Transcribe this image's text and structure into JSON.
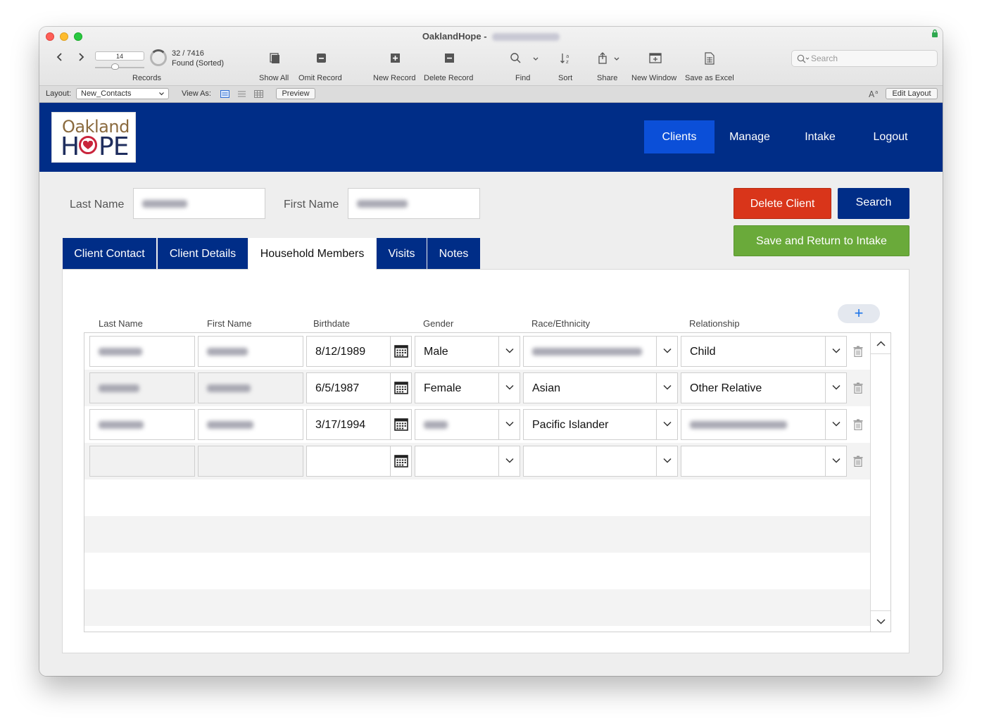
{
  "window": {
    "title": "OaklandHope - "
  },
  "toolbar": {
    "record_number": "14",
    "found_count": "32 / 7416",
    "found_label": "Found (Sorted)",
    "records_label": "Records",
    "show_all": "Show All",
    "omit_record": "Omit Record",
    "new_record": "New Record",
    "delete_record": "Delete Record",
    "find": "Find",
    "sort": "Sort",
    "share": "Share",
    "new_window": "New Window",
    "save_as_excel": "Save as Excel",
    "search_placeholder": "Search"
  },
  "layoutbar": {
    "layout_label": "Layout:",
    "layout_value": "New_Contacts",
    "view_as_label": "View As:",
    "preview": "Preview",
    "edit_layout": "Edit Layout"
  },
  "banner": {
    "logo_top": "Oakland",
    "logo_bottom_left": "H",
    "logo_bottom_right": "PE",
    "nav": [
      "Clients",
      "Manage",
      "Intake",
      "Logout"
    ],
    "active_nav": "Clients",
    "colors": {
      "banner": "#002d87",
      "active": "#0b4fd8"
    }
  },
  "form": {
    "last_name_label": "Last Name",
    "first_name_label": "First Name",
    "delete_client": "Delete Client",
    "search": "Search",
    "save_return": "Save and Return to Intake",
    "colors": {
      "delete": "#d9351a",
      "search": "#002d87",
      "save": "#6aaa3a"
    }
  },
  "tabs": [
    "Client Contact",
    "Client Details",
    "Household Members",
    "Visits",
    "Notes"
  ],
  "active_tab": "Household Members",
  "household": {
    "columns": [
      "Last Name",
      "First Name",
      "Birthdate",
      "Gender",
      "Race/Ethnicity",
      "Relationship"
    ],
    "add_label": "+",
    "rows": [
      {
        "birthdate": "8/12/1989",
        "gender": "Male",
        "race": "",
        "relationship": "Child"
      },
      {
        "birthdate": "6/5/1987",
        "gender": "Female",
        "race": "Asian",
        "relationship": "Other Relative"
      },
      {
        "birthdate": "3/17/1994",
        "gender": "",
        "race": "Pacific Islander",
        "relationship": ""
      },
      {
        "birthdate": "",
        "gender": "",
        "race": "",
        "relationship": ""
      }
    ]
  }
}
